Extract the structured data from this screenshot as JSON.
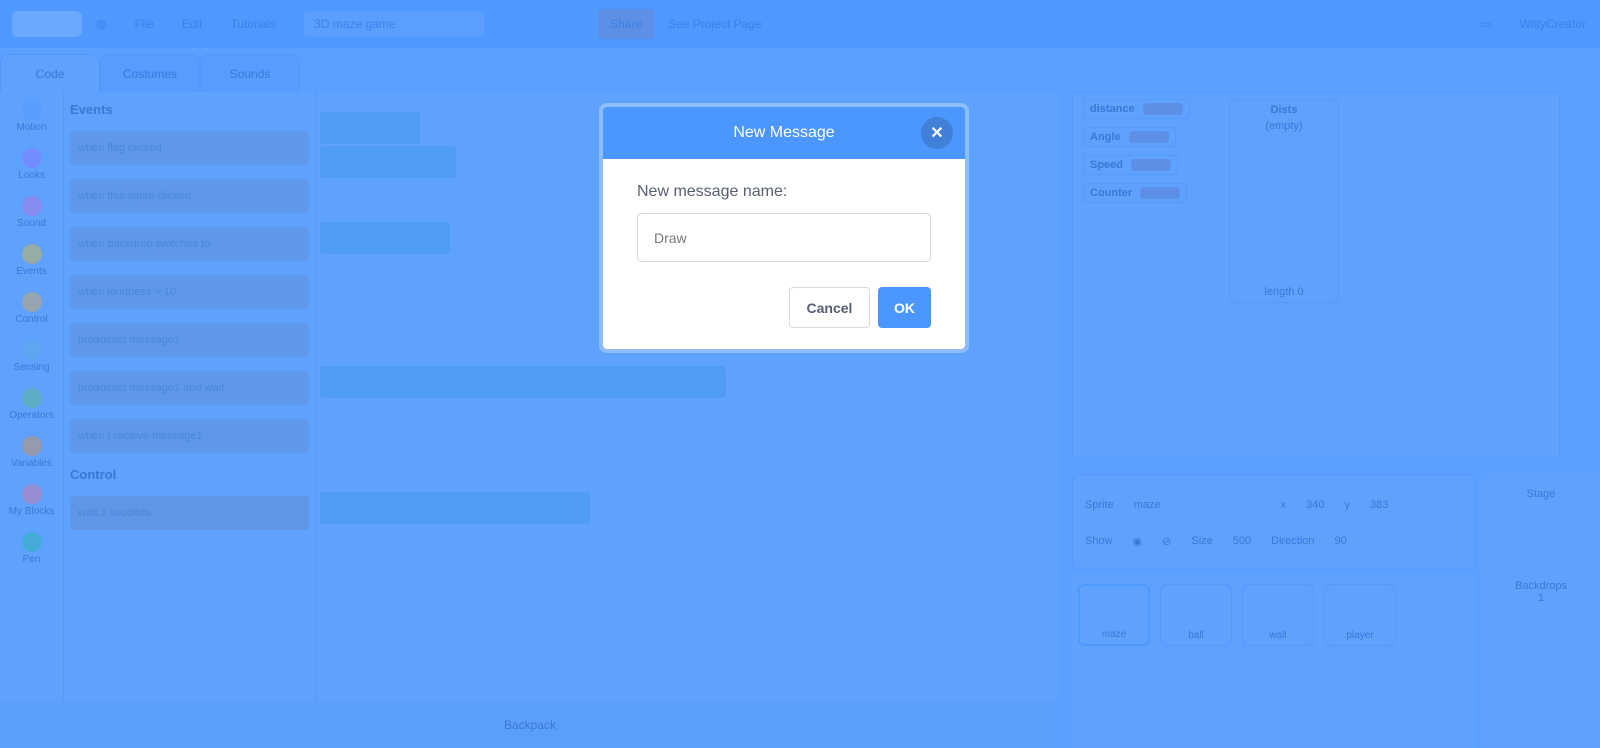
{
  "menubar": {
    "items": [
      "File",
      "Edit"
    ],
    "tutorials": "Tutorials",
    "project_title": "3D maze game",
    "share": "Share",
    "see_project": "See Project Page",
    "username": "WittyCreator"
  },
  "tabs": [
    "Code",
    "Costumes",
    "Sounds"
  ],
  "categories": [
    {
      "label": "Motion",
      "color": "#4c97ff"
    },
    {
      "label": "Looks",
      "color": "#9966ff"
    },
    {
      "label": "Sound",
      "color": "#cf63cf"
    },
    {
      "label": "Events",
      "color": "#ffbf00"
    },
    {
      "label": "Control",
      "color": "#ffab19"
    },
    {
      "label": "Sensing",
      "color": "#5cb1d6"
    },
    {
      "label": "Operators",
      "color": "#59c059"
    },
    {
      "label": "Variables",
      "color": "#ff8c1a"
    },
    {
      "label": "My Blocks",
      "color": "#ff6680"
    },
    {
      "label": "Pen",
      "color": "#0fbd8c"
    }
  ],
  "palette": {
    "events_heading": "Events",
    "control_heading": "Control",
    "blocks": [
      "when flag clicked",
      "when this sprite clicked",
      "when backdrop switches to",
      "when loudness > 10",
      "broadcast message1",
      "broadcast message1 and wait",
      "when I receive message1"
    ],
    "control_blocks": [
      "wait 1 seconds"
    ]
  },
  "backpack": "Backpack",
  "monitors": [
    {
      "label": "distance",
      "value": ""
    },
    {
      "label": "Angle",
      "value": ""
    },
    {
      "label": "Speed",
      "value": ""
    },
    {
      "label": "Counter",
      "value": ""
    }
  ],
  "list": {
    "title": "Dists",
    "empty": "(empty)",
    "length": "length 0"
  },
  "sprite_info": {
    "sprite_label": "Sprite",
    "sprite_name": "maze",
    "x_label": "x",
    "x": "340",
    "y_label": "y",
    "y": "383",
    "show_label": "Show",
    "size_label": "Size",
    "size": "500",
    "direction_label": "Direction",
    "direction": "90"
  },
  "sprites": [
    "maze",
    "ball",
    "wall",
    "player"
  ],
  "stage_panel": {
    "label": "Stage",
    "backdrops_label": "Backdrops",
    "backdrops": "1"
  },
  "modal": {
    "title": "New Message",
    "label": "New message name:",
    "input_value": "Draw",
    "cancel": "Cancel",
    "ok": "OK"
  }
}
